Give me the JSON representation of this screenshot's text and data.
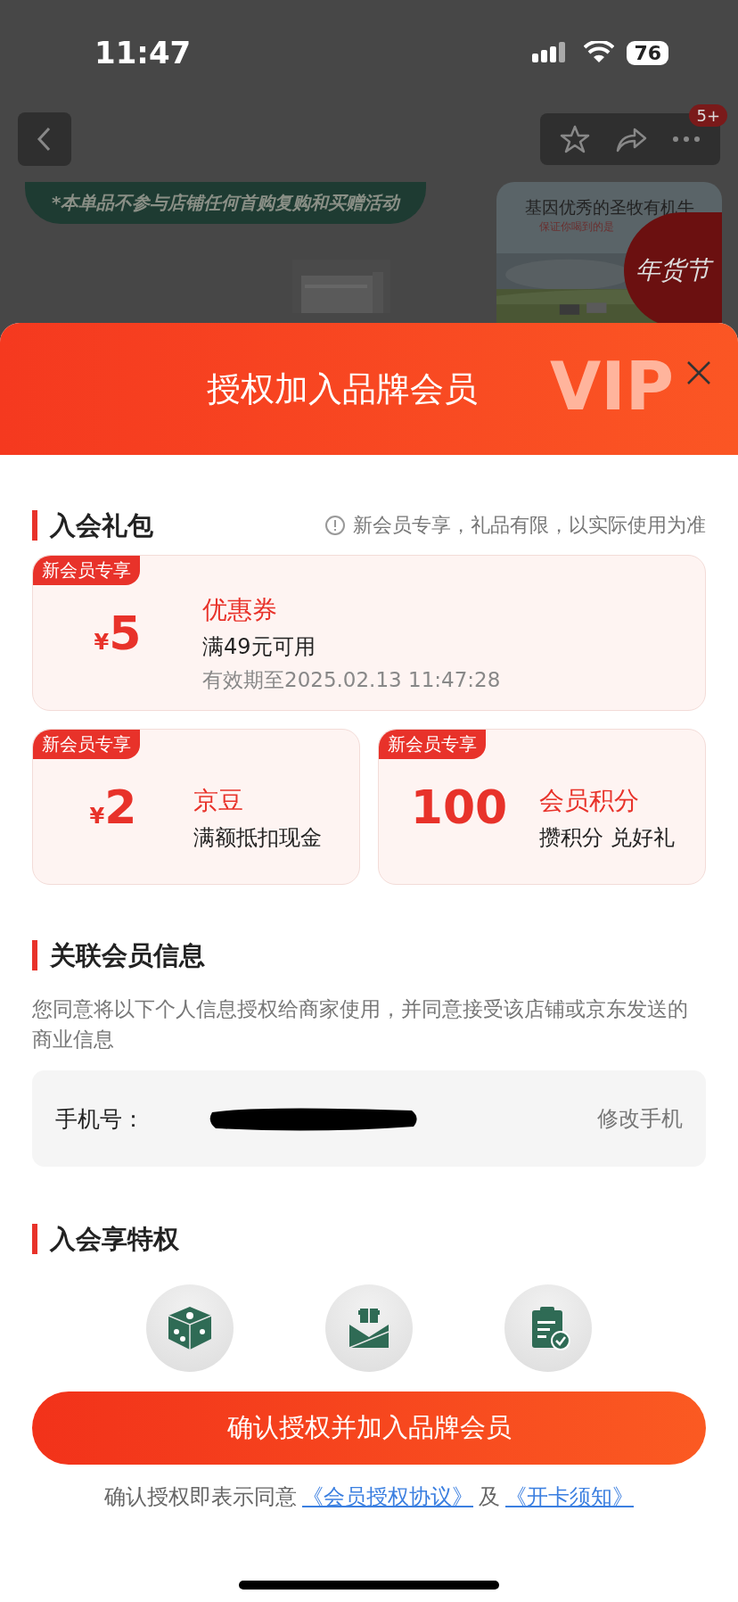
{
  "status_bar": {
    "time": "11:47",
    "battery": "76"
  },
  "nav": {
    "badge": "5+"
  },
  "background": {
    "banner": "*本单品不参与店铺任何首购复购和买赠活动",
    "card_title": "基因优秀的圣牧有机牛",
    "card_subtitle": "保证你喝到的是",
    "festival_badge": "年货节"
  },
  "sheet": {
    "title": "授权加入品牌会员",
    "decoration": "VIP",
    "gift_section": {
      "title": "入会礼包",
      "note": "新会员专享，礼品有限，以实际使用为准",
      "gifts": [
        {
          "kind": "wide",
          "badge": "新会员专享",
          "currency": "¥",
          "amount": "5",
          "name": "优惠券",
          "desc": "满49元可用",
          "validity": "有效期至2025.02.13 11:47:28"
        },
        {
          "kind": "half",
          "badge": "新会员专享",
          "currency": "¥",
          "amount": "2",
          "name": "京豆",
          "desc": "满额抵扣现金"
        },
        {
          "kind": "half",
          "badge": "新会员专享",
          "amount": "100",
          "name": "会员积分",
          "desc": "攒积分 兑好礼"
        }
      ]
    },
    "info_section": {
      "title": "关联会员信息",
      "text": "您同意将以下个人信息授权给商家使用，并同意接受该店铺或京东发送的商业信息",
      "phone_label": "手机号：",
      "change_link": "修改手机"
    },
    "privilege_section": {
      "title": "入会享特权",
      "privileges": [
        {
          "kind": "dice"
        },
        {
          "kind": "gift"
        },
        {
          "kind": "clipboard"
        }
      ]
    },
    "confirm_button": "确认授权并加入品牌会员",
    "agreement": {
      "text": "确认授权即表示同意",
      "links": [
        "《会员授权协议》",
        "《开卡须知》"
      ],
      "joiner": "及"
    }
  }
}
